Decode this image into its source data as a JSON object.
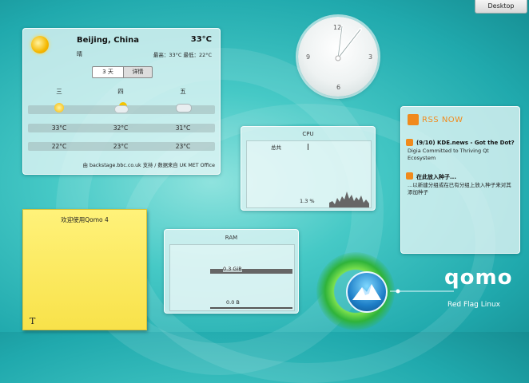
{
  "desktop_button": {
    "label": "Desktop"
  },
  "weather": {
    "city": "Beijing, China",
    "temp": "33°C",
    "condition": "晴",
    "range": "最高：33°C 最低：22°C",
    "tabs": [
      "3 天",
      "详情"
    ],
    "days": [
      {
        "name": "三",
        "icon": "sun-icon",
        "high": "33°C",
        "low": "22°C"
      },
      {
        "name": "四",
        "icon": "partly-cloudy-icon",
        "high": "32°C",
        "low": "23°C"
      },
      {
        "name": "五",
        "icon": "cloud-icon",
        "high": "31°C",
        "low": "23°C"
      }
    ],
    "source": "由 backstage.bbc.co.uk 支持 / 数据来自 UK MET Office"
  },
  "clock": {
    "numbers": [
      "12",
      "3",
      "6",
      "9"
    ]
  },
  "cpu": {
    "title": "CPU",
    "label": "总共",
    "percent": "1.3 %",
    "level": 0.013
  },
  "ram": {
    "title": "RAM",
    "used": "0.3 GiB",
    "swap": "0.0 B"
  },
  "rss": {
    "header": "RSS NOW",
    "items": [
      {
        "title": "(9/10) KDE.news - Got the Dot?",
        "body": "Digia Committed to Thriving Qt Ecosystem"
      },
      {
        "title": "在此放入种子...",
        "body": "...以新建分组或在已有分组上放入种子来对其添加种子"
      }
    ]
  },
  "note": {
    "text": "欢迎使用Qomo 4",
    "format_button": "T"
  },
  "brand": {
    "name": "qomo",
    "subtitle": "Red Flag Linux"
  }
}
